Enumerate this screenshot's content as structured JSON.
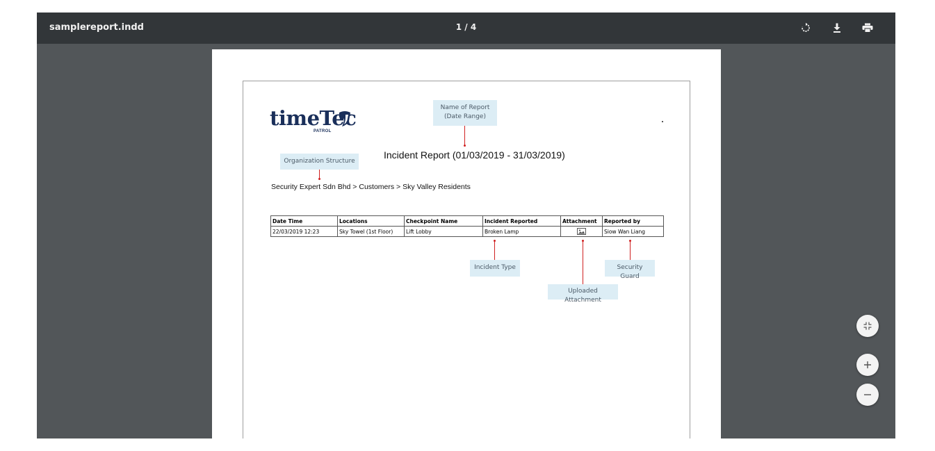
{
  "toolbar": {
    "filename": "samplereport.indd",
    "page_indicator": "1 / 4",
    "icons": [
      "rotate-icon",
      "download-icon",
      "print-icon"
    ]
  },
  "report": {
    "logo_main": "timeTec",
    "logo_sub": "PATROL",
    "title": "Incident Report (01/03/2019 - 31/03/2019)",
    "org_path": "Security Expert Sdn Bhd > Customers > Sky Valley Residents",
    "table": {
      "headers": [
        "Date Time",
        "Locations",
        "Checkpoint Name",
        "Incident Reported",
        "Attachment",
        "Reported by"
      ],
      "rows": [
        {
          "datetime": "22/03/2019 12:23",
          "location": "Sky Towel (1st Floor)",
          "checkpoint": "Lift Lobby",
          "incident": "Broken Lamp",
          "reported_by": "Siow Wan Liang"
        }
      ]
    }
  },
  "callouts": {
    "name_of_report_1": "Name of Report",
    "name_of_report_2": "(Date Range)",
    "org_structure": "Organization Structure",
    "incident_type": "Incident Type",
    "uploaded_attachment": "Uploaded Attachment",
    "security_guard": "Security Guard"
  },
  "zoom_controls": [
    "fit-to-page-icon",
    "zoom-in-icon",
    "zoom-out-icon"
  ],
  "colors": {
    "toolbar_bg": "#323639",
    "viewer_bg": "#525659",
    "callout_bg": "#dcedf5",
    "callout_line": "#d02020",
    "brand_navy": "#1a2f5a"
  }
}
